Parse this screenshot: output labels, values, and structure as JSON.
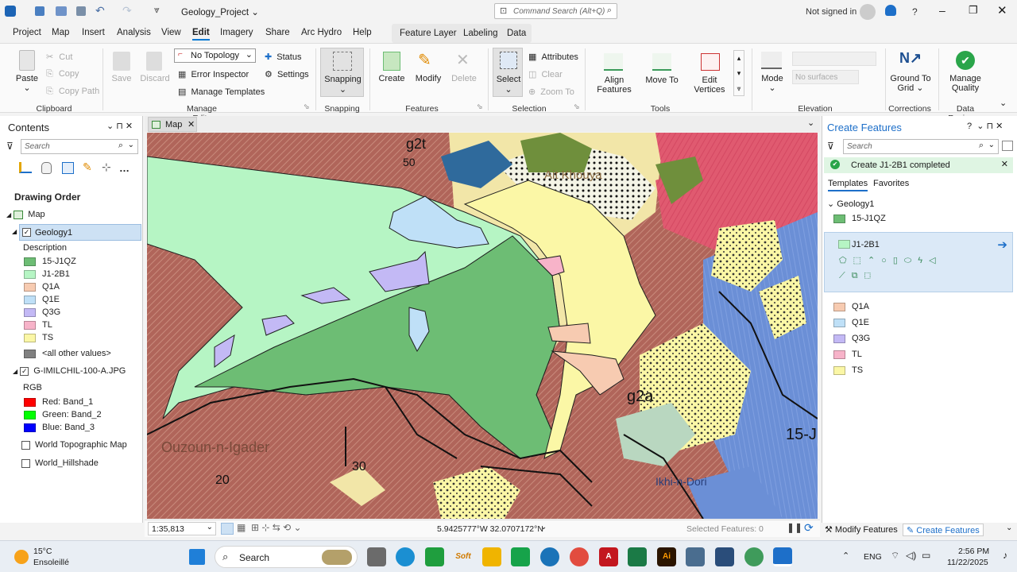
{
  "titlebar": {
    "project": "Geology_Project",
    "command_search": "Command Search (Alt+Q)",
    "signed_in": "Not signed in",
    "help": "?"
  },
  "menu": {
    "items": [
      "Project",
      "Map",
      "Insert",
      "Analysis",
      "View",
      "Edit",
      "Imagery",
      "Share",
      "Arc Hydro",
      "Help"
    ],
    "context_tabs": [
      "Feature Layer",
      "Labeling",
      "Data"
    ]
  },
  "ribbon": {
    "clipboard": {
      "paste": "Paste",
      "cut": "Cut",
      "copy": "Copy",
      "copy_path": "Copy Path",
      "group": "Clipboard"
    },
    "manage_edits": {
      "save": "Save",
      "discard": "Discard",
      "topology": "No Topology",
      "status": "Status",
      "error_inspector": "Error Inspector",
      "settings": "Settings",
      "manage_templates": "Manage Templates",
      "group": "Manage Edits"
    },
    "snapping": {
      "label": "Snapping",
      "group": "Snapping"
    },
    "features": {
      "create": "Create",
      "modify": "Modify",
      "delete": "Delete",
      "group": "Features"
    },
    "selection": {
      "select": "Select",
      "attributes": "Attributes",
      "clear": "Clear",
      "zoom_to": "Zoom To",
      "group": "Selection"
    },
    "tools": {
      "align": "Align Features",
      "move": "Move To",
      "edit_vertices": "Edit Vertices",
      "group": "Tools"
    },
    "elevation": {
      "mode": "Mode",
      "surfaces_placeholder": "No surfaces",
      "group": "Elevation"
    },
    "corrections": {
      "ground": "Ground To Grid",
      "group": "Corrections"
    },
    "reviewer": {
      "manage": "Manage Quality",
      "group": "Data Reviewer"
    }
  },
  "contents": {
    "title": "Contents",
    "search_placeholder": "Search",
    "drawing_order": "Drawing Order",
    "map": "Map",
    "layer": "Geology1",
    "description": "Description",
    "legend": [
      {
        "label": "15-J1QZ",
        "color": "#6dbd74"
      },
      {
        "label": "J1-2B1",
        "color": "#b6f5c4"
      },
      {
        "label": "Q1A",
        "color": "#f7cbb1"
      },
      {
        "label": "Q1E",
        "color": "#bfe0f7"
      },
      {
        "label": "Q3G",
        "color": "#c3b9f5"
      },
      {
        "label": "TL",
        "color": "#f7b3c9"
      },
      {
        "label": "TS",
        "color": "#fbf7a6"
      },
      {
        "label": "<all other values>",
        "color": "#808080"
      }
    ],
    "raster": "G-IMILCHIL-100-A.JPG",
    "rgb": "RGB",
    "bands": [
      {
        "label": "Red: Band_1",
        "color": "#ff0000"
      },
      {
        "label": "Green: Band_2",
        "color": "#00ff00"
      },
      {
        "label": "Blue: Band_3",
        "color": "#0000ff"
      }
    ],
    "basemaps": [
      "World Topographic Map",
      "World_Hillshade"
    ]
  },
  "map": {
    "tab": "Map",
    "scale": "1:35,813",
    "coords": "5.9425777°W 32.0707172°N",
    "selected": "Selected Features: 0",
    "labels": [
      {
        "text": "g2t"
      },
      {
        "text": "50"
      },
      {
        "text": "Ait Khouya"
      },
      {
        "text": "g2a"
      },
      {
        "text": "15-J"
      },
      {
        "text": "Ouzoun-n-Igader"
      },
      {
        "text": "30"
      },
      {
        "text": "20"
      },
      {
        "text": "Ikhi-n-Dori"
      }
    ]
  },
  "create_features": {
    "title": "Create Features",
    "search_placeholder": "Search",
    "notice": "Create J1-2B1 completed",
    "tabs": [
      "Templates",
      "Favorites"
    ],
    "group": "Geology1",
    "top_template": {
      "label": "15-J1QZ",
      "color": "#6dbd74"
    },
    "selected": {
      "label": "J1-2B1",
      "color": "#b6f5c4"
    },
    "templates": [
      {
        "label": "Q1A",
        "color": "#f7cbb1"
      },
      {
        "label": "Q1E",
        "color": "#bfe0f7"
      },
      {
        "label": "Q3G",
        "color": "#c3b9f5"
      },
      {
        "label": "TL",
        "color": "#f7b3c9"
      },
      {
        "label": "TS",
        "color": "#fbf7a6"
      }
    ]
  },
  "bottom_tabs": {
    "modify": "Modify Features",
    "create": "Create Features"
  },
  "taskbar": {
    "temp": "15°C",
    "weather": "Ensoleillé",
    "search": "Search",
    "lang": "ENG",
    "time": "2:56 PM",
    "date": "11/22/2025"
  }
}
